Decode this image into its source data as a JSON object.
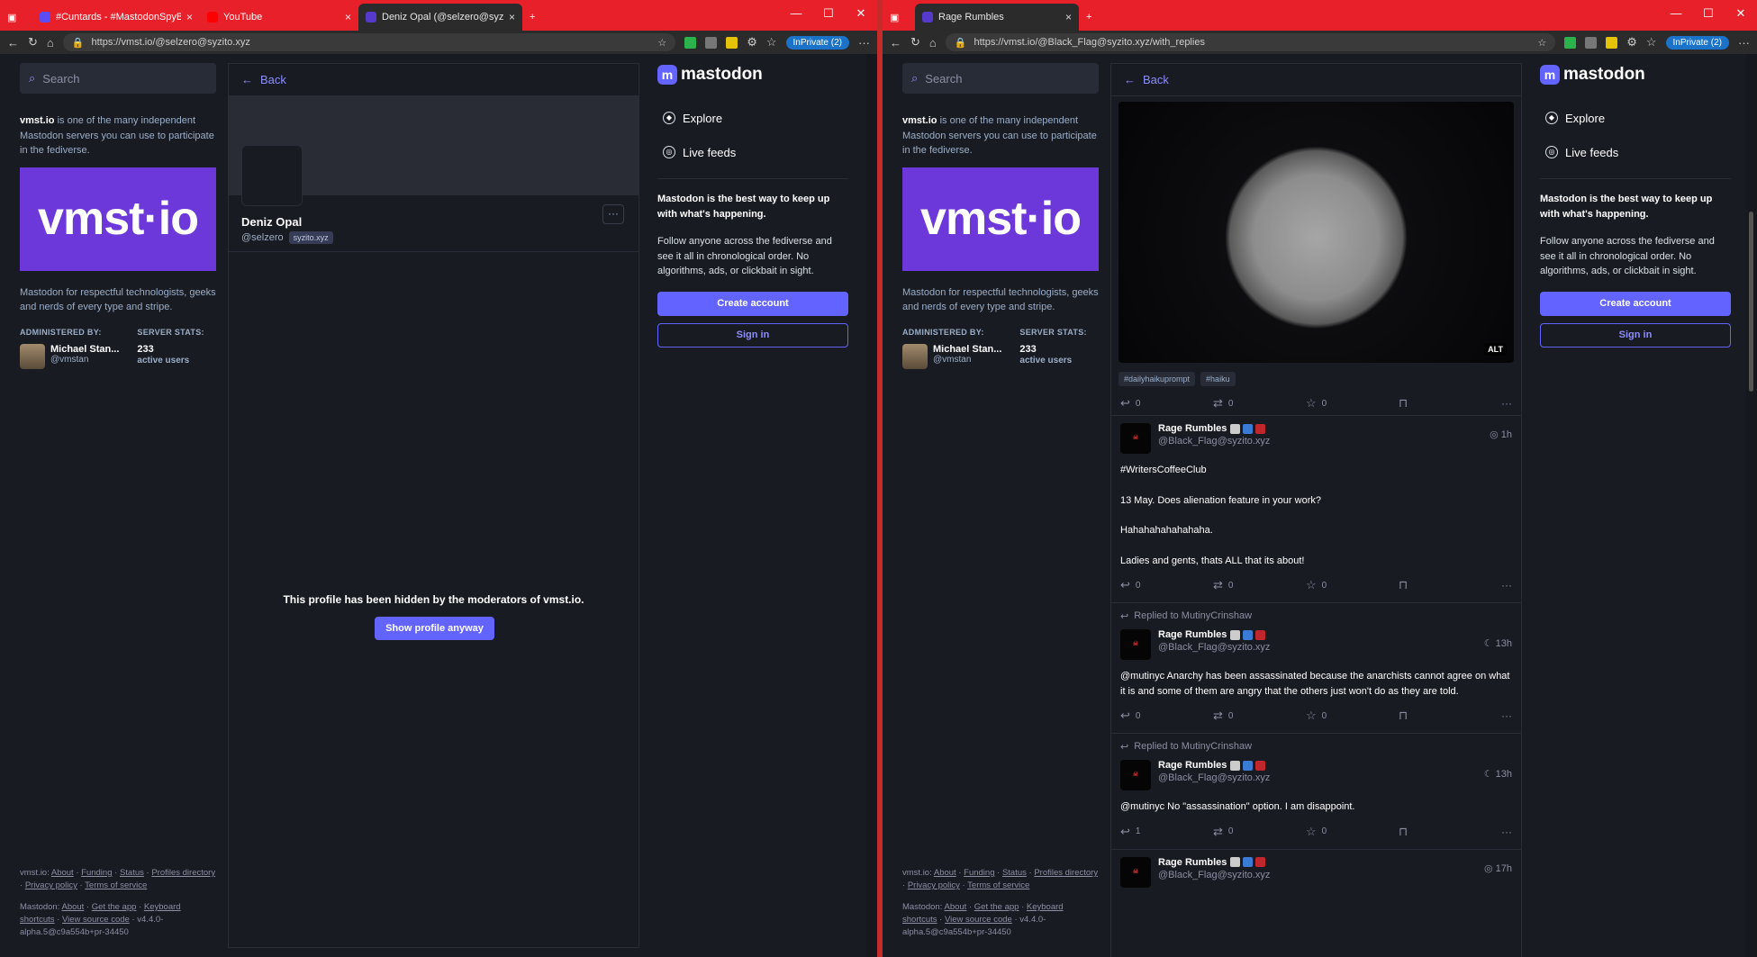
{
  "left": {
    "tabs": [
      {
        "label": "#Cuntards - #MastodonSpyBallo",
        "color": "#5b4cf5"
      },
      {
        "label": "YouTube",
        "color": "#ff0000"
      },
      {
        "label": "Deniz Opal (@selzero@syzito.xyz",
        "color": "#563acc"
      }
    ],
    "url": "https://vmst.io/@selzero@syzito.xyz",
    "inprivate": "InPrivate (2)",
    "search_placeholder": "Search",
    "server_name": "vmst.io",
    "server_intro": " is one of the many independent Mastodon servers you can use to participate in the fediverse.",
    "hero_text": "vmst·io",
    "server_desc": "Mastodon for respectful technologists, geeks and nerds of every type and stripe.",
    "administered_by": "ADMINISTERED BY:",
    "server_stats": "SERVER STATS:",
    "admin_name": "Michael Stan...",
    "admin_handle": "@vmstan",
    "stat_number": "233",
    "stat_label": "active users",
    "footer_site": "vmst.io:",
    "footer_links": [
      "About",
      "Funding",
      "Status",
      "Profiles directory",
      "Privacy policy",
      "Terms of service"
    ],
    "footer_mastodon": "Mastodon:",
    "footer_mastodon_links": [
      "About",
      "Get the app",
      "Keyboard shortcuts",
      "View source code"
    ],
    "version": "v4.4.0-alpha.5@c9a554b+pr-34450",
    "back_label": "Back",
    "profile_name": "Deniz Opal",
    "profile_handle": "@selzero",
    "profile_domain": "syzito.xyz",
    "hidden_message": "This profile has been hidden by the moderators of vmst.io.",
    "show_button": "Show profile anyway",
    "logo_text": "mastodon",
    "nav": [
      {
        "label": "Explore",
        "icon": "compass-icon"
      },
      {
        "label": "Live feeds",
        "icon": "globe-icon"
      }
    ],
    "pitch_bold": "Mastodon is the best way to keep up with what's happening.",
    "pitch_text": "Follow anyone across the fediverse and see it all in chronological order. No algorithms, ads, or clickbait in sight.",
    "create_account": "Create account",
    "sign_in": "Sign in"
  },
  "right": {
    "tabs": [
      {
        "label": "Rage Rumbles",
        "color": "#563acc"
      }
    ],
    "url": "https://vmst.io/@Black_Flag@syzito.xyz/with_replies",
    "media_alt": "ALT",
    "tags": [
      "#dailyhaikuprompt",
      "#haiku"
    ],
    "media_actions": {
      "reply": "0",
      "boost": "0",
      "fav": "0"
    },
    "posts": [
      {
        "reply_to": "",
        "name": "Rage Rumbles",
        "handle": "@Black_Flag@syzito.xyz",
        "time": "1h",
        "paragraphs": [
          "#WritersCoffeeClub",
          "13 May. Does alienation feature in your work?",
          "Hahahahahahahaha.",
          "Ladies and gents, thats ALL that its about!"
        ],
        "reply": "0",
        "boost": "0",
        "fav": "0"
      },
      {
        "reply_to": "Replied to MutinyCrinshaw",
        "name": "Rage Rumbles",
        "handle": "@Black_Flag@syzito.xyz",
        "time": "13h",
        "paragraphs": [
          "@mutinyc Anarchy has been assassinated because the anarchists cannot agree on what it is and some of them are angry that the others just won't do as they are told."
        ],
        "reply": "0",
        "boost": "0",
        "fav": "0"
      },
      {
        "reply_to": "Replied to MutinyCrinshaw",
        "name": "Rage Rumbles",
        "handle": "@Black_Flag@syzito.xyz",
        "time": "13h",
        "paragraphs": [
          "@mutinyc No \"assassination\" option. I am disappoint."
        ],
        "reply": "1",
        "boost": "0",
        "fav": "0"
      },
      {
        "reply_to": "",
        "name": "Rage Rumbles",
        "handle": "@Black_Flag@syzito.xyz",
        "time": "17h",
        "paragraphs": [],
        "reply": "",
        "boost": "",
        "fav": ""
      }
    ]
  },
  "colors": {
    "accent": "#6364ff",
    "bg": "#191b22",
    "tabbar": "#e8202a",
    "hero": "#6d38d9"
  }
}
